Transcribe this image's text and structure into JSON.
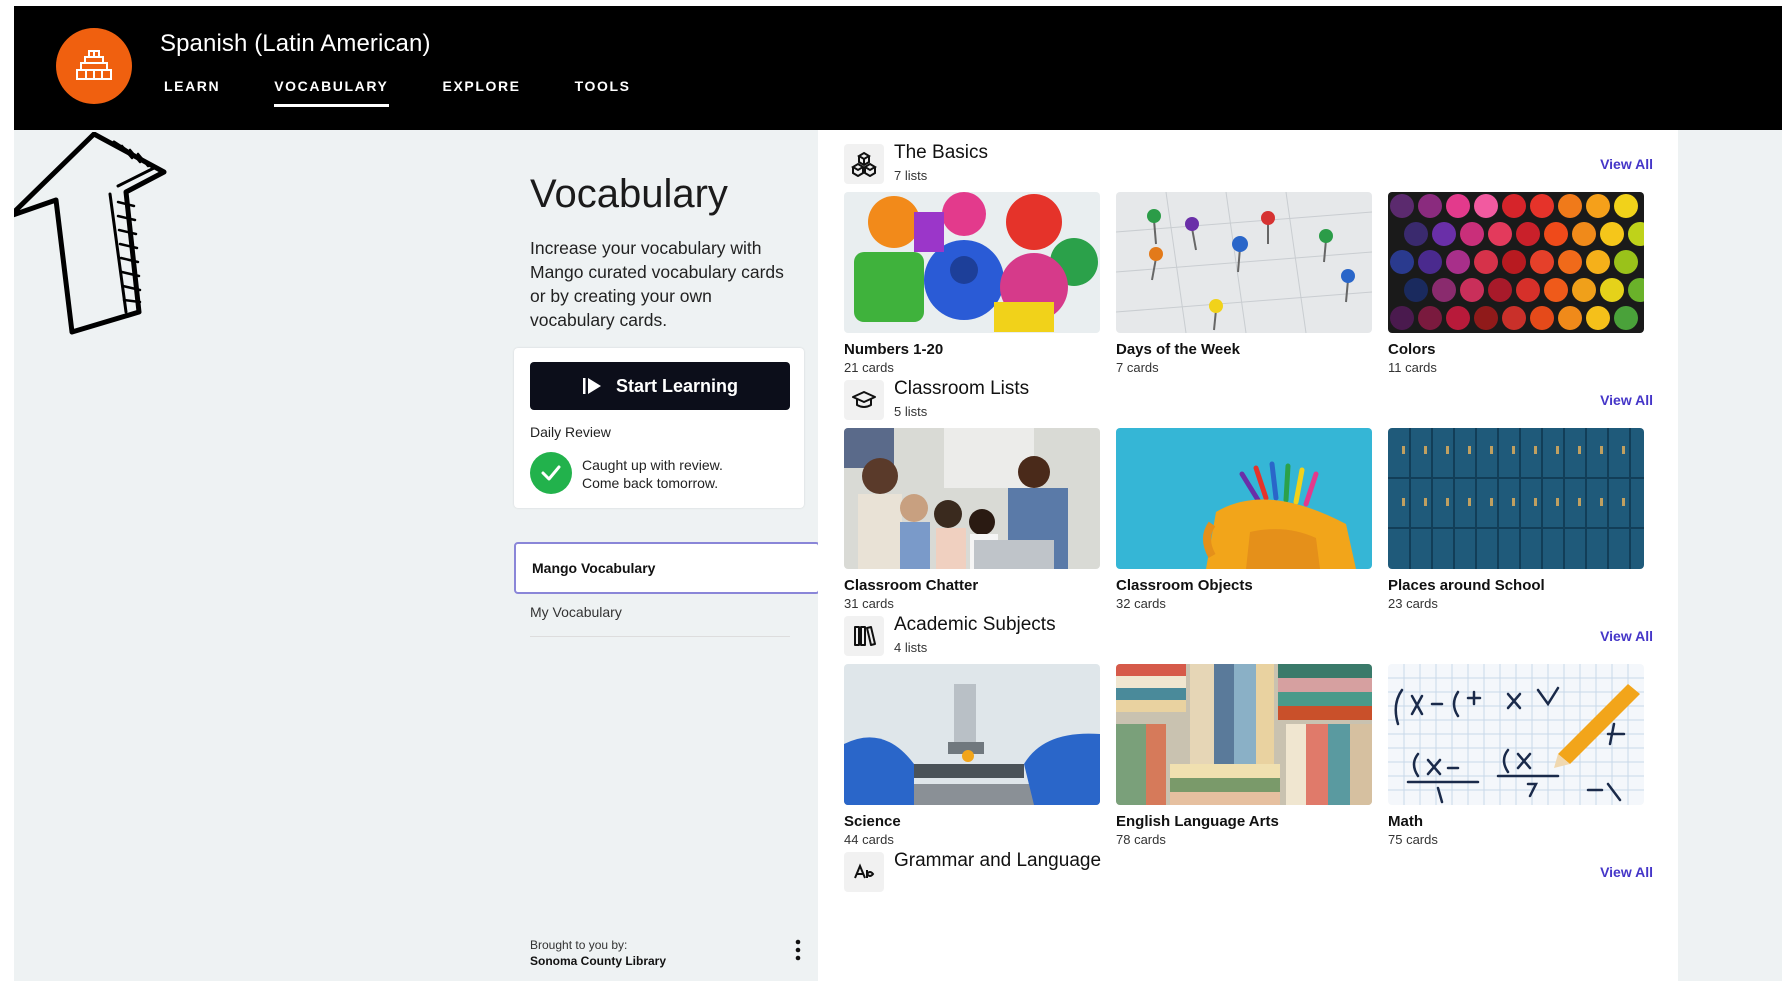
{
  "header": {
    "title": "Spanish (Latin American)",
    "nav": [
      "LEARN",
      "VOCABULARY",
      "EXPLORE",
      "TOOLS"
    ],
    "active_tab": "VOCABULARY"
  },
  "sidebar": {
    "page_title": "Vocabulary",
    "description": "Increase your vocabulary with Mango curated vocabulary cards or by creating your own vocabulary cards.",
    "start_button": "Start Learning",
    "daily_review_label": "Daily Review",
    "review_message_1": "Caught up with review.",
    "review_message_2": "Come back tomorrow.",
    "tabs": [
      "Mango Vocabulary",
      "My Vocabulary"
    ],
    "brought_by_label": "Brought to you by:",
    "brought_by_name": "Sonoma County Library"
  },
  "sections": [
    {
      "title": "The Basics",
      "count": "7 lists",
      "view_all": "View All",
      "icon": "cubes-icon",
      "cards": [
        {
          "title": "Numbers 1-20",
          "count": "21 cards"
        },
        {
          "title": "Days of the Week",
          "count": "7 cards"
        },
        {
          "title": "Colors",
          "count": "11 cards"
        }
      ]
    },
    {
      "title": "Classroom Lists",
      "count": "5 lists",
      "view_all": "View All",
      "icon": "graduation-cap-icon",
      "cards": [
        {
          "title": "Classroom Chatter",
          "count": "31 cards"
        },
        {
          "title": "Classroom Objects",
          "count": "32 cards"
        },
        {
          "title": "Places around School",
          "count": "23 cards"
        }
      ]
    },
    {
      "title": "Academic Subjects",
      "count": "4 lists",
      "view_all": "View All",
      "icon": "books-icon",
      "cards": [
        {
          "title": "Science",
          "count": "44 cards"
        },
        {
          "title": "English Language Arts",
          "count": "78 cards"
        },
        {
          "title": "Math",
          "count": "75 cards"
        }
      ]
    },
    {
      "title": "Grammar and Language",
      "view_all": "View All",
      "icon": "grammar-icon"
    }
  ],
  "colors": {
    "accent": "#f0600f",
    "link": "#4536c8",
    "success": "#22b24c",
    "header_bg": "#000000"
  }
}
